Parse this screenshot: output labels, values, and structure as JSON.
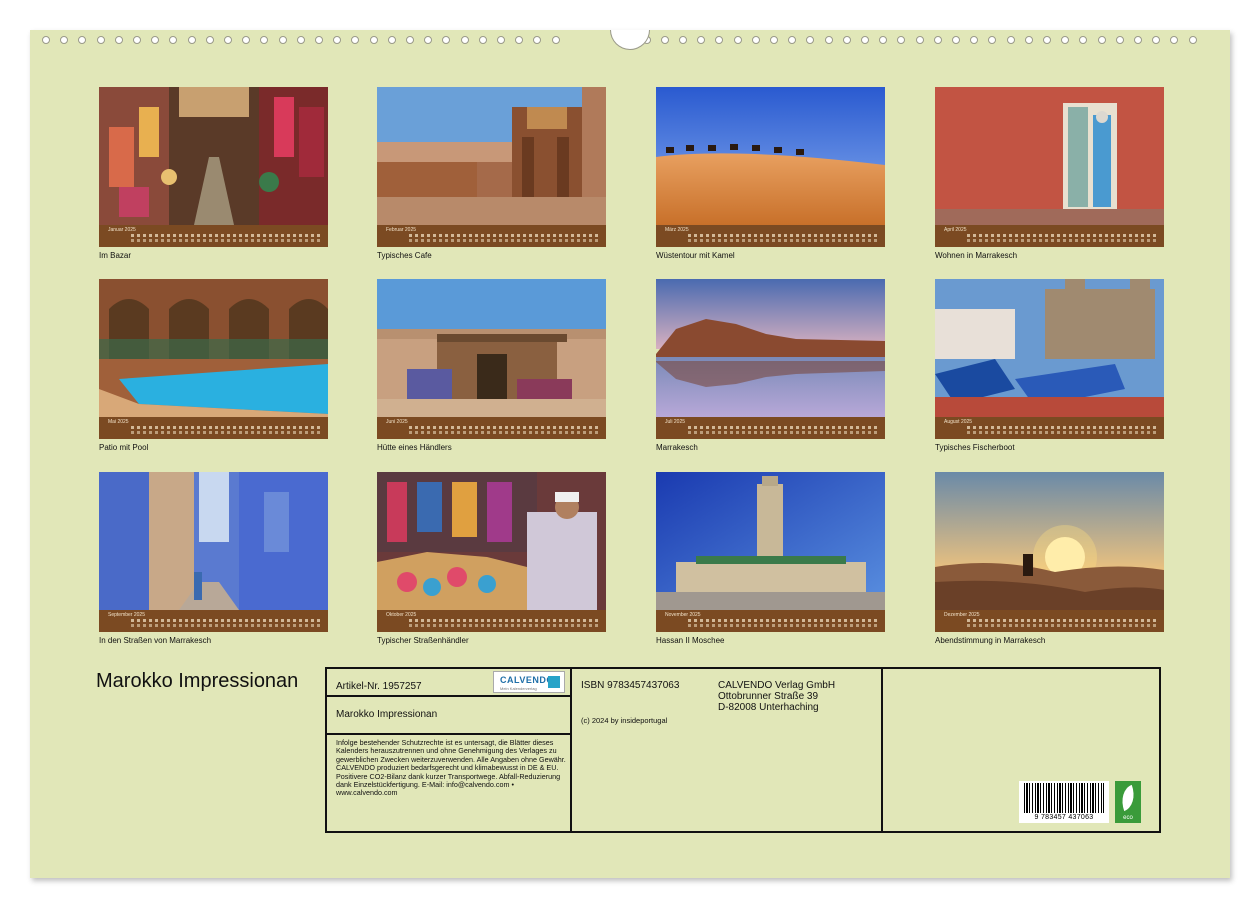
{
  "calendar_title": "Marokko Impressionan",
  "months": [
    {
      "month": "Januar 2025",
      "caption": "Im Bazar"
    },
    {
      "month": "Februar 2025",
      "caption": "Typisches Cafe"
    },
    {
      "month": "März 2025",
      "caption": "Wüstentour mit Kamel"
    },
    {
      "month": "April 2025",
      "caption": "Wohnen in Marrakesch"
    },
    {
      "month": "Mai 2025",
      "caption": "Patio mit Pool"
    },
    {
      "month": "Juni 2025",
      "caption": "Hütte eines Händlers"
    },
    {
      "month": "Juli 2025",
      "caption": "Marrakesch"
    },
    {
      "month": "August 2025",
      "caption": "Typisches Fischerboot"
    },
    {
      "month": "September 2025",
      "caption": "In den Straßen von Marrakesch"
    },
    {
      "month": "Oktober 2025",
      "caption": "Typischer Straßenhändler"
    },
    {
      "month": "November 2025",
      "caption": "Hassan II Moschee"
    },
    {
      "month": "Dezember 2025",
      "caption": "Abendstimmung in Marrakesch"
    }
  ],
  "info": {
    "article_no": "Artikel-Nr. 1957257",
    "logo_text": "CALVENDO",
    "logo_sub": "Mein Kalenderverlag",
    "title": "Marokko Impressionan",
    "legal": "Infolge bestehender Schutzrechte ist es untersagt, die Blätter dieses Kalenders herauszutrennen und ohne Genehmigung des Verlages zu gewerblichen Zwecken weiterzuverwenden. Alle Angaben ohne Gewähr. CALVENDO produziert bedarfsgerecht und klimabewusst in DE & EU. Positivere CO2-Bilanz dank kurzer Transportwege. Abfall-Reduzierung dank Einzelstückfertigung. E-Mail: info@calvendo.com • www.calvendo.com",
    "isbn": "ISBN 9783457437063",
    "copyright": "(c) 2024 by insideportugal",
    "publisher_name": "CALVENDO Verlag GmbH",
    "publisher_street": "Ottobrunner Straße 39",
    "publisher_city": "D-82008 Unterhaching",
    "barcode_number": "9 783457 437063",
    "eco_label": "eco"
  },
  "colors": {
    "sheet": "#e1e7b8",
    "strip": "#7b4a22"
  }
}
